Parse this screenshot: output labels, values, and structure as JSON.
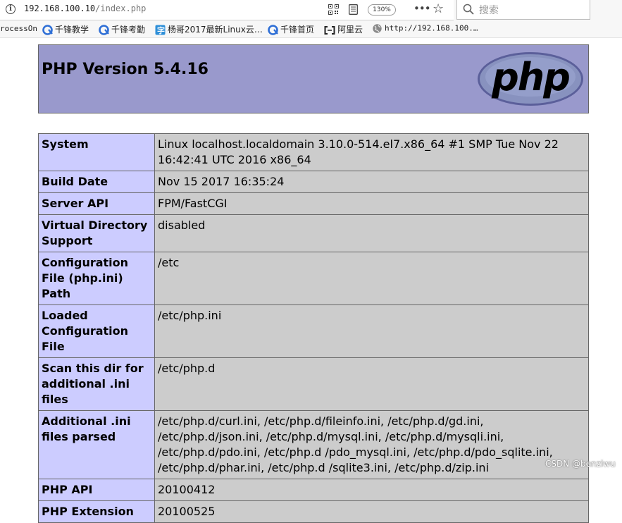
{
  "browser": {
    "url_host": "192.168.100.10",
    "url_path": "/index.php",
    "zoom": "130%",
    "search_placeholder": "搜索",
    "bookmarks": [
      "rocessOn",
      "千锋教学",
      "千锋考勤",
      "杨哥2017最新Linux云…",
      "千锋首页",
      "阿里云",
      "http://192.168.100.…"
    ]
  },
  "phpinfo": {
    "title": "PHP Version 5.4.16",
    "logo_text": "php",
    "rows": [
      {
        "key": "System",
        "value": "Linux localhost.localdomain 3.10.0-514.el7.x86_64 #1 SMP Tue Nov 22 16:42:41 UTC 2016 x86_64"
      },
      {
        "key": "Build Date",
        "value": "Nov 15 2017 16:35:24"
      },
      {
        "key": "Server API",
        "value": "FPM/FastCGI"
      },
      {
        "key": "Virtual Directory Support",
        "value": "disabled"
      },
      {
        "key": "Configuration File (php.ini) Path",
        "value": "/etc"
      },
      {
        "key": "Loaded Configuration File",
        "value": "/etc/php.ini"
      },
      {
        "key": "Scan this dir for additional .ini files",
        "value": "/etc/php.d"
      },
      {
        "key": "Additional .ini files parsed",
        "value": "/etc/php.d/curl.ini, /etc/php.d/fileinfo.ini, /etc/php.d/gd.ini, /etc/php.d/json.ini, /etc/php.d/mysql.ini, /etc/php.d/mysqli.ini, /etc/php.d/pdo.ini, /etc/php.d /pdo_mysql.ini, /etc/php.d/pdo_sqlite.ini, /etc/php.d/phar.ini, /etc/php.d /sqlite3.ini, /etc/php.d/zip.ini"
      },
      {
        "key": "PHP API",
        "value": "20100412"
      },
      {
        "key": "PHP Extension",
        "value": "20100525"
      }
    ]
  },
  "watermark": "CSDN @benziwu"
}
